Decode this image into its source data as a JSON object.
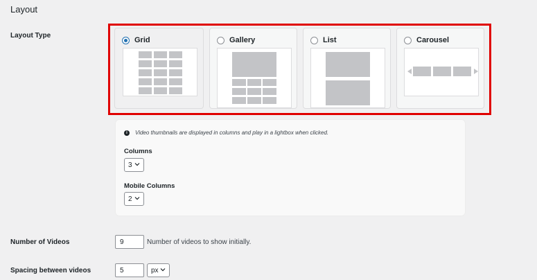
{
  "section": {
    "title": "Layout"
  },
  "layout_type": {
    "label": "Layout Type",
    "options": [
      {
        "label": "Grid",
        "selected": true
      },
      {
        "label": "Gallery",
        "selected": false
      },
      {
        "label": "List",
        "selected": false
      },
      {
        "label": "Carousel",
        "selected": false
      }
    ]
  },
  "info": {
    "icon": "info-icon",
    "text": "Video thumbnails are displayed in columns and play in a lightbox when clicked."
  },
  "columns": {
    "label": "Columns",
    "value": "3"
  },
  "mobile_columns": {
    "label": "Mobile Columns",
    "value": "2"
  },
  "number_of_videos": {
    "label": "Number of Videos",
    "value": "9",
    "help": "Number of videos to show initially."
  },
  "spacing": {
    "label": "Spacing between videos",
    "value": "5",
    "unit": "px"
  },
  "colors": {
    "highlight": "#e00000",
    "accent": "#2271b1",
    "placeholder": "#c3c4c7"
  }
}
